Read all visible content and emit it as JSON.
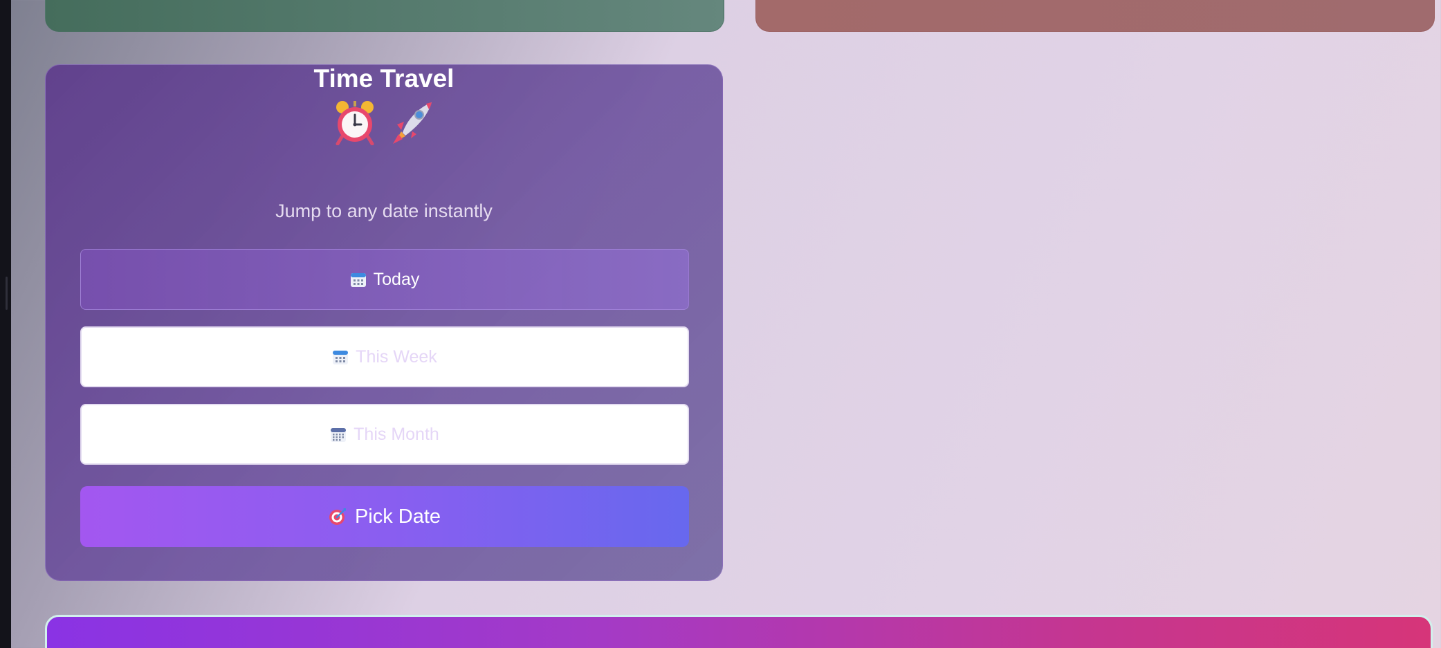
{
  "time_travel": {
    "emojis": [
      "alarm-clock-icon",
      "rocket-icon"
    ],
    "title": "Time Travel",
    "subtitle": "Jump to any date instantly",
    "buttons": {
      "today": "Today",
      "this_week": "This Week",
      "this_month": "This Month",
      "pick_date": "Pick Date"
    }
  },
  "colors": {
    "card_purple": "#6f4f9e",
    "pick_gradient_start": "#a357f0",
    "pick_gradient_end": "#6768ee",
    "banner_start": "#8a33e4",
    "banner_end": "#d63579",
    "top_left_card": "#557a6d",
    "top_right_card": "#a36a6a"
  }
}
